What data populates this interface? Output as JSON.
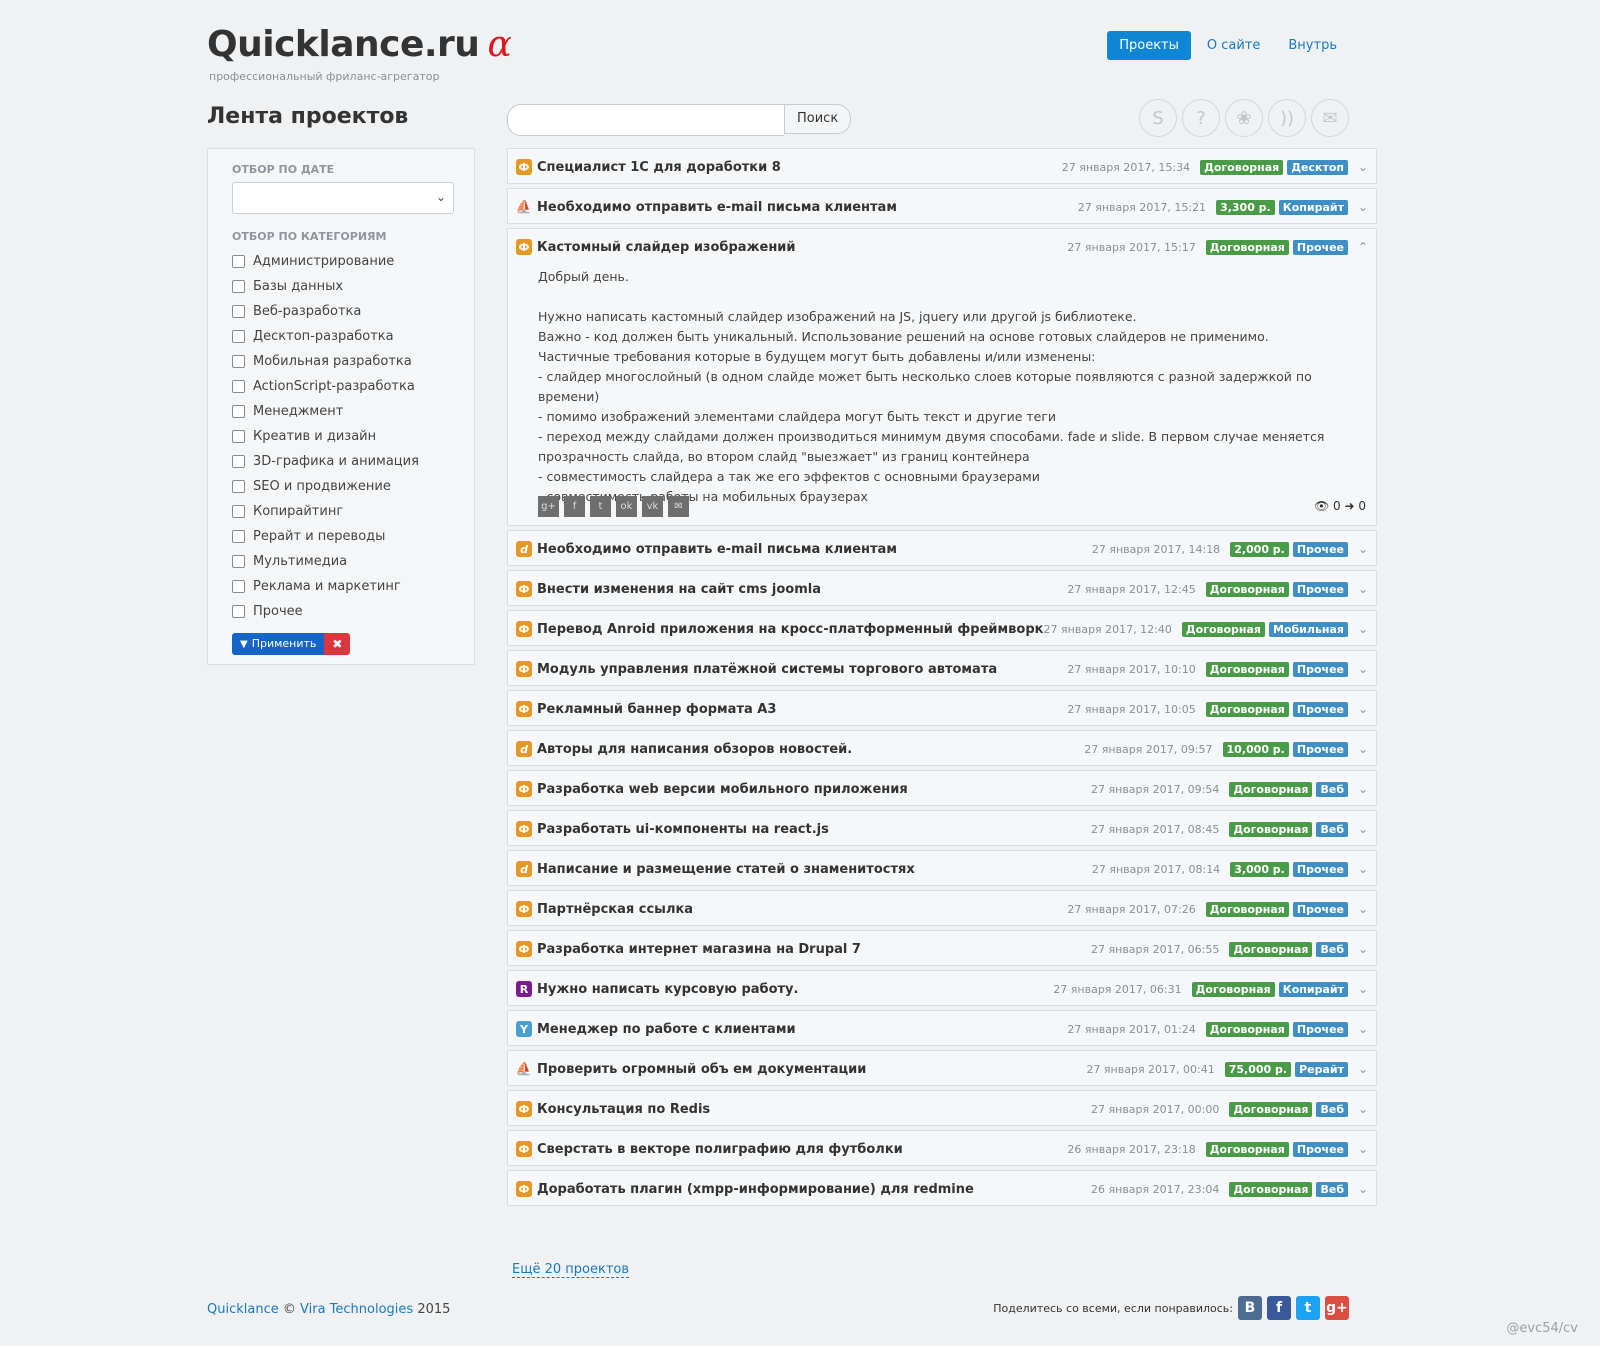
{
  "header": {
    "logo_text": "Quicklance.ru",
    "logo_alpha": "α",
    "tagline": "профессиональный фриланс-агрегатор",
    "nav": [
      {
        "label": "Проекты",
        "active": true
      },
      {
        "label": "О сайте",
        "active": false
      },
      {
        "label": "Внутрь",
        "active": false
      }
    ]
  },
  "page_title": "Лента проектов",
  "sidebar": {
    "date_filter_title": "ОТБОР ПО ДАТЕ",
    "date_select_value": "",
    "category_filter_title": "ОТБОР ПО КАТЕГОРИЯМ",
    "categories": [
      "Администрирование",
      "Базы данных",
      "Веб-разработка",
      "Десктоп-разработка",
      "Мобильная разработка",
      "ActionScript-разработка",
      "Менеджмент",
      "Креатив и дизайн",
      "3D-графика и анимация",
      "SEO и продвижение",
      "Копирайтинг",
      "Рерайт и переводы",
      "Мультимедиа",
      "Реклама и маркетинг",
      "Прочее"
    ],
    "apply_label": "Применить",
    "clear_icon": "✖"
  },
  "search": {
    "value": "",
    "button_label": "Поиск"
  },
  "social_icons": [
    "skype-icon",
    "question-icon",
    "flower-icon",
    "rss-icon",
    "mail-icon"
  ],
  "projects": [
    {
      "source": "fl",
      "title": "Специалист 1С для доработки 8",
      "date": "27 января 2017, 15:34",
      "price": "Договорная",
      "category": "Десктоп"
    },
    {
      "source": "sail",
      "title": "Необходимо отправить e-mail письма клиентам",
      "date": "27 января 2017, 15:21",
      "price": "3,300 р.",
      "category": "Копирайт"
    },
    {
      "source": "fl",
      "title": "Кастомный слайдер изображений",
      "date": "27 января 2017, 15:17",
      "price": "Договорная",
      "category": "Прочее",
      "open": true
    },
    {
      "source": "wl",
      "title": "Необходимо отправить e-mail письма клиентам",
      "date": "27 января 2017, 14:18",
      "price": "2,000 р.",
      "category": "Прочее"
    },
    {
      "source": "fl",
      "title": "Внести изменения на сайт cms joomla",
      "date": "27 января 2017, 12:45",
      "price": "Договорная",
      "category": "Прочее"
    },
    {
      "source": "fl",
      "title": "Перевод Anroid приложения на кросс-платформенный фреймворк",
      "date": "27 января 2017, 12:40",
      "price": "Договорная",
      "category": "Мобильная"
    },
    {
      "source": "fl",
      "title": "Модуль управления платёжной системы торгового автомата",
      "date": "27 января 2017, 10:10",
      "price": "Договорная",
      "category": "Прочее"
    },
    {
      "source": "fl",
      "title": "Рекламный баннер формата А3",
      "date": "27 января 2017, 10:05",
      "price": "Договорная",
      "category": "Прочее"
    },
    {
      "source": "wl",
      "title": "Авторы для написания обзоров новостей.",
      "date": "27 января 2017, 09:57",
      "price": "10,000 р.",
      "category": "Прочее"
    },
    {
      "source": "fl",
      "title": "Разработка web версии мобильного приложения",
      "date": "27 января 2017, 09:54",
      "price": "Договорная",
      "category": "Веб"
    },
    {
      "source": "fl",
      "title": "Разработать ui-компоненты на react.js",
      "date": "27 января 2017, 08:45",
      "price": "Договорная",
      "category": "Веб"
    },
    {
      "source": "wl",
      "title": "Написание и размещение статей о знаменитостях",
      "date": "27 января 2017, 08:14",
      "price": "3,000 р.",
      "category": "Прочее"
    },
    {
      "source": "fl",
      "title": "Партнёрская ссылка",
      "date": "27 января 2017, 07:26",
      "price": "Договорная",
      "category": "Прочее"
    },
    {
      "source": "fl",
      "title": "Разработка интернет магазина на Drupal 7",
      "date": "27 января 2017, 06:55",
      "price": "Договорная",
      "category": "Веб"
    },
    {
      "source": "rs",
      "title": "Нужно написать курсовую работу.",
      "date": "27 января 2017, 06:31",
      "price": "Договорная",
      "category": "Копирайт"
    },
    {
      "source": "yk",
      "title": "Менеджер по работе с клиентами",
      "date": "27 января 2017, 01:24",
      "price": "Договорная",
      "category": "Прочее"
    },
    {
      "source": "sail",
      "title": "Проверить огромный объ ем документации",
      "date": "27 января 2017, 00:41",
      "price": "75,000 р.",
      "category": "Рерайт"
    },
    {
      "source": "fl",
      "title": "Консультация по Redis",
      "date": "27 января 2017, 00:00",
      "price": "Договорная",
      "category": "Веб"
    },
    {
      "source": "fl",
      "title": "Сверстать в векторе полиграфию для футболки",
      "date": "26 января 2017, 23:18",
      "price": "Договорная",
      "category": "Прочее"
    },
    {
      "source": "fl",
      "title": "Доработать плагин (xmpp-информирование) для redmine",
      "date": "26 января 2017, 23:04",
      "price": "Договорная",
      "category": "Веб"
    }
  ],
  "open_project": {
    "description": [
      "Добрый день.",
      "",
      "Нужно написать кастомный слайдер изображений на JS, jquery или другой js библиотеке.",
      "Важно - код должен быть уникальный. Использование решений на основе готовых слайдеров не применимо.",
      "Частичные требования которые в будущем могут быть добавлены и/или изменены:",
      "- слайдер многослойный (в одном слайде может быть несколько слоев которые появляются с разной задержкой по времени)",
      "- помимо изображений элементами слайдера могут быть текст и другие теги",
      "- переход между слайдами должен производиться минимум двумя способами. fade и slide. В первом случае меняется прозрачность слайда, во втором слайд \"выезжает\" из границ контейнера",
      "- совместимость слайдера а так же его эффектов с основными браузерами",
      "- совместимость работы на мобильных браузерах"
    ],
    "share_icons": [
      "g+",
      "f",
      "t",
      "ok",
      "vk",
      "✉"
    ],
    "views": "0",
    "clicks": "0"
  },
  "more_link": "Ещё 20 проектов",
  "footer": {
    "brand": "Quicklance",
    "copyright": "©",
    "company": "Vira Technologies",
    "year": "2015",
    "share_text": "Поделитесь со всеми, если понравилось:",
    "share_buttons": [
      "B",
      "f",
      "t",
      "g+"
    ]
  },
  "credit": "@evc54/cv",
  "colors": {
    "accent": "#0e86d4",
    "price_badge": "#4a9b47",
    "category_badge": "#3e8fc6"
  }
}
